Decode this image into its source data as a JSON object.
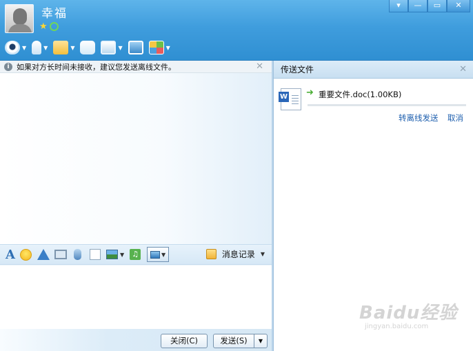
{
  "contact": {
    "name": "幸福",
    "avatar": "default-avatar",
    "status_icons": [
      "star-icon",
      "refresh-icon"
    ]
  },
  "window_controls": [
    "minimize-menu-icon",
    "minimize-icon",
    "maximize-icon",
    "close-icon"
  ],
  "window_glyphs": {
    "menu": "▾",
    "min": "—",
    "max": "▭",
    "close": "✕"
  },
  "toolbar": [
    "webcam-icon",
    "mic-icon",
    "file-transfer-icon",
    "message-icon",
    "remote-assist-icon",
    "screen-share-icon",
    "apps-icon"
  ],
  "notice": {
    "text": "如果对方长时间未接收，建议您发送离线文件。",
    "info_glyph": "i",
    "close_glyph": "✕"
  },
  "chat_tools": {
    "font_glyph": "A",
    "history_label": "消息记录"
  },
  "buttons": {
    "close": "关闭(C)",
    "send": "发送(S)",
    "dropdown_glyph": "▼"
  },
  "transfer_panel": {
    "title": "传送文件",
    "close_glyph": "✕",
    "file_name": "重要文件.doc(1.00KB)",
    "progress": 0,
    "actions": {
      "send_offline": "转离线发送",
      "cancel": "取消"
    }
  },
  "watermark": {
    "main": "Baidu经验",
    "sub": "jingyan.baidu.com"
  },
  "colors": {
    "header_top": "#5eb4ea",
    "header_bottom": "#2f8fd2",
    "link": "#1e5fae"
  }
}
